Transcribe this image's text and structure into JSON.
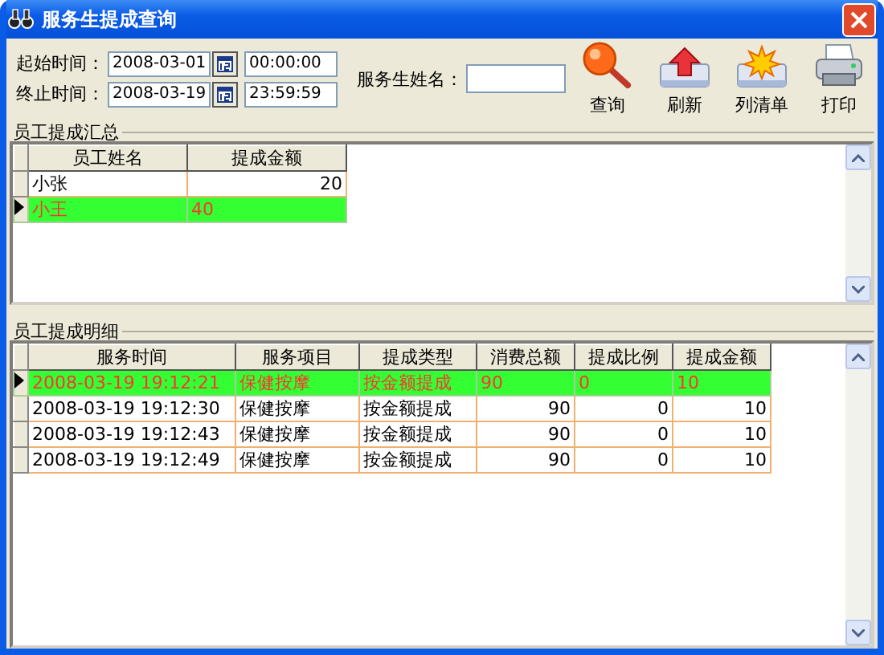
{
  "window": {
    "title": "服务生提成查询"
  },
  "filters": {
    "ranges": [
      {
        "label": "起始时间：",
        "date": "2008-03-01",
        "time": "00:00:00"
      },
      {
        "label": "终止时间：",
        "date": "2008-03-19",
        "time": "23:59:59"
      }
    ],
    "waiter": {
      "label": "服务生姓名："
    }
  },
  "toolbar": [
    {
      "label": "查询",
      "kind": "search"
    },
    {
      "label": "刷新",
      "kind": "refresh"
    },
    {
      "label": "列清单",
      "kind": "list"
    },
    {
      "label": "打印",
      "kind": "print"
    }
  ],
  "summary": {
    "title": "员工提成汇总",
    "columns": [
      {
        "label": "员工姓名",
        "kind": "text"
      },
      {
        "label": "提成金额",
        "kind": "number"
      }
    ],
    "rows": [
      {
        "cells": [
          "小张",
          "20"
        ],
        "selected": false
      },
      {
        "cells": [
          "小王",
          "40"
        ],
        "selected": true
      }
    ]
  },
  "detail": {
    "title": "员工提成明细",
    "columns": [
      {
        "label": "服务时间",
        "kind": "text"
      },
      {
        "label": "服务项目",
        "kind": "text"
      },
      {
        "label": "提成类型",
        "kind": "text"
      },
      {
        "label": "消费总额",
        "kind": "number"
      },
      {
        "label": "提成比例",
        "kind": "number"
      },
      {
        "label": "提成金额",
        "kind": "number"
      }
    ],
    "rows": [
      {
        "cells": [
          "2008-03-19 19:12:21",
          "保健按摩",
          "按金额提成",
          "90",
          "0",
          "10"
        ],
        "selected": true
      },
      {
        "cells": [
          "2008-03-19 19:12:30",
          "保健按摩",
          "按金额提成",
          "90",
          "0",
          "10"
        ],
        "selected": false
      },
      {
        "cells": [
          "2008-03-19 19:12:43",
          "保健按摩",
          "按金额提成",
          "90",
          "0",
          "10"
        ],
        "selected": false
      },
      {
        "cells": [
          "2008-03-19 19:12:49",
          "保健按摩",
          "按金额提成",
          "90",
          "0",
          "10"
        ],
        "selected": false
      }
    ]
  }
}
